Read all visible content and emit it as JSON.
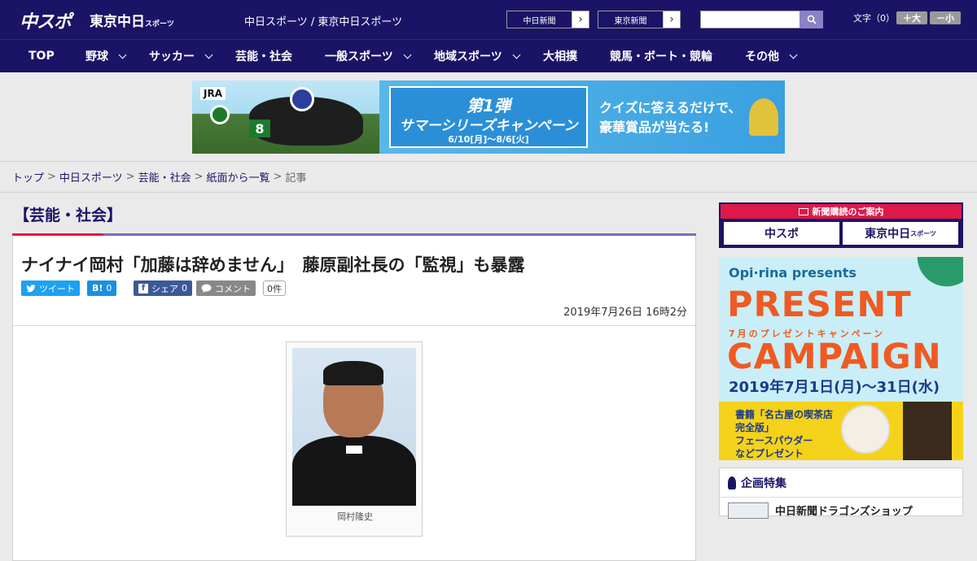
{
  "header": {
    "logo_main": "中スポ",
    "logo_tokyo": "東京中日",
    "logo_tokyo_small": "スポーツ",
    "site_links": "中日スポーツ / 東京中日スポーツ",
    "paper_links": [
      "中日新聞",
      "東京新聞"
    ],
    "search_placeholder": "",
    "fontsize_label": "文字（0）",
    "font_plus": "＋大",
    "font_minus": "－小"
  },
  "nav": {
    "items": [
      {
        "label": "TOP",
        "dropdown": false
      },
      {
        "label": "野球",
        "dropdown": true
      },
      {
        "label": "サッカー",
        "dropdown": true
      },
      {
        "label": "芸能・社会",
        "dropdown": false
      },
      {
        "label": "一般スポーツ",
        "dropdown": true
      },
      {
        "label": "地域スポーツ",
        "dropdown": true
      },
      {
        "label": "大相撲",
        "dropdown": false
      },
      {
        "label": "競馬・ボート・競輪",
        "dropdown": false
      },
      {
        "label": "その他",
        "dropdown": true
      }
    ]
  },
  "ad_banner": {
    "jra": "JRA",
    "horse_number": "8",
    "line1": "第1弾",
    "line2": "サマーシリーズキャンペーン",
    "line3": "6/10[月]～8/6[火]",
    "quiz_line1": "クイズに答えるだけで、",
    "quiz_line2": "豪華賞品が当たる!"
  },
  "breadcrumb": {
    "items": [
      "トップ",
      "中日スポーツ",
      "芸能・社会",
      "紙面から一覧"
    ],
    "current": "記事"
  },
  "article": {
    "category": "【芸能・社会】",
    "headline": "ナイナイ岡村「加藤は辞めません」　藤原副社長の「監視」も暴露",
    "share": {
      "tweet": "ツイート",
      "hatena": "B!",
      "hatena_count": "0",
      "facebook": "シェア",
      "facebook_count": "0",
      "comment": "コメント",
      "comment_count": "0件"
    },
    "date": "2019年7月26日 16時2分",
    "photo_caption": "岡村隆史"
  },
  "sidebar": {
    "subscribe_head": "新聞購読のご案内",
    "subscribe_buttons": [
      "中スポ",
      "東京中日"
    ],
    "subscribe_small": "スポーツ",
    "promo": {
      "brand": "Opi·rina presents",
      "big1": "PRESENT",
      "sub": "7月のプレゼントキャンペーン",
      "big2": "CAMPAIGN",
      "dates": "2019年7月1日(月)～31日(水)",
      "desc_line1": "書籍「名古屋の喫茶店",
      "desc_line2": "完全版」",
      "desc_line3": "フェースパウダー",
      "desc_line4": "などプレゼント"
    },
    "feature_title": "企画特集",
    "feature_item": "中日新聞ドラゴンズショップ"
  },
  "colors": {
    "navy": "#1b1466",
    "accent_red": "#e0184a",
    "tweet": "#1da1f2",
    "facebook": "#3b5998",
    "comment": "#888888"
  }
}
